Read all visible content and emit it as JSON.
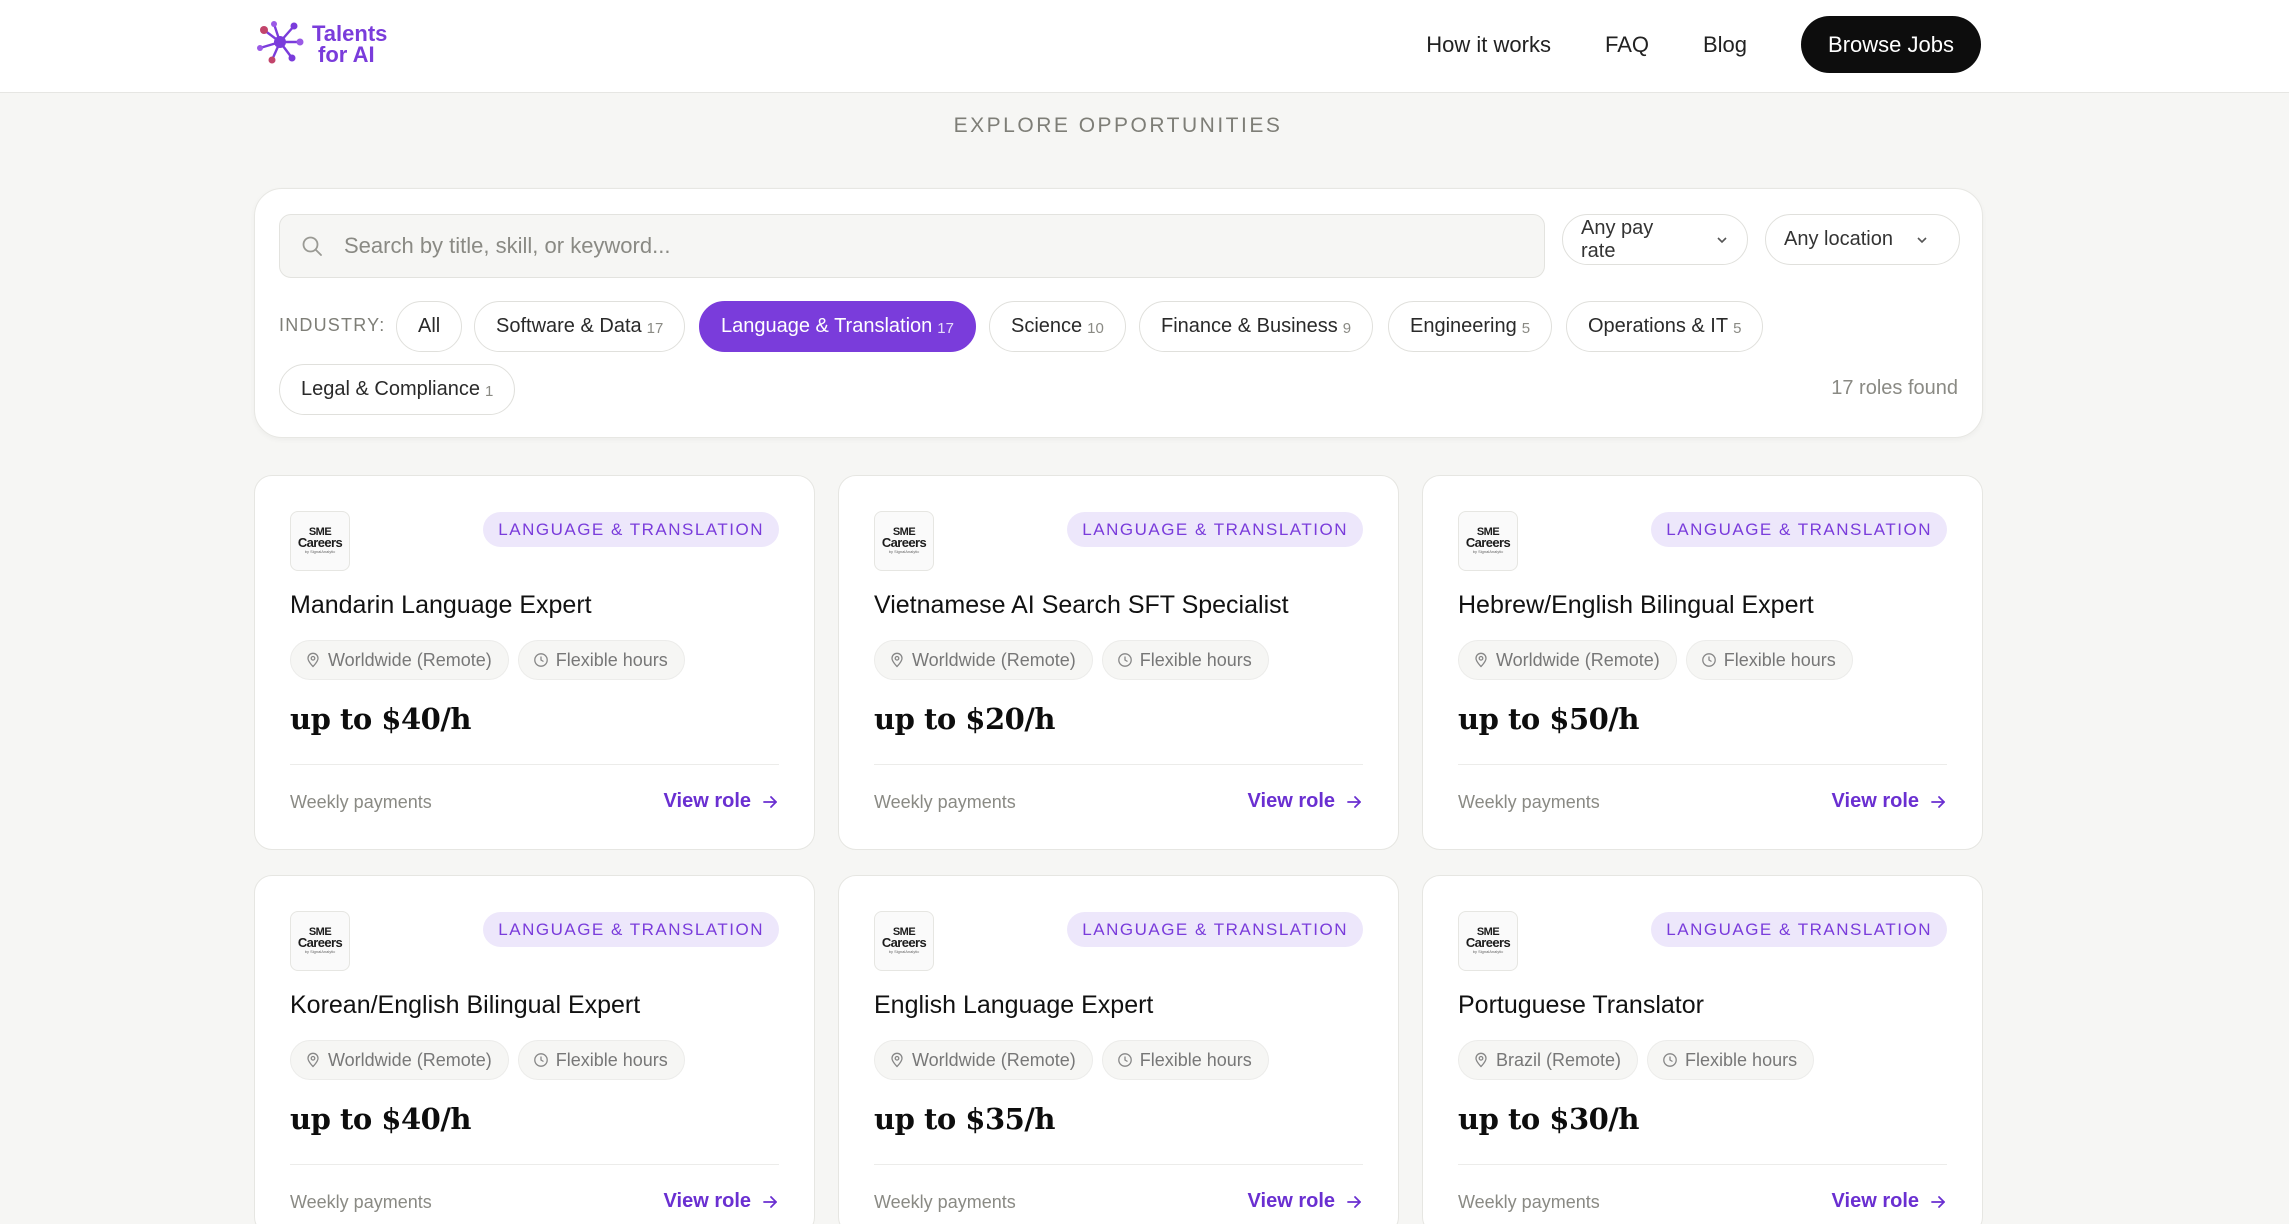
{
  "header": {
    "logo_line1": "Talents",
    "logo_line2": "for AI",
    "nav": [
      {
        "label": "How it works"
      },
      {
        "label": "FAQ"
      },
      {
        "label": "Blog"
      }
    ],
    "cta_label": "Browse Jobs"
  },
  "section": {
    "heading": "EXPLORE OPPORTUNITIES"
  },
  "filters": {
    "search_placeholder": "Search by title, skill, or keyword...",
    "search_value": "",
    "pay_rate": "Any pay rate",
    "location": "Any location",
    "industry_label": "INDUSTRY:",
    "industries": [
      {
        "label": "All",
        "count": ""
      },
      {
        "label": "Software & Data",
        "count": "17"
      },
      {
        "label": "Language & Translation",
        "count": "17"
      },
      {
        "label": "Science",
        "count": "10"
      },
      {
        "label": "Finance & Business",
        "count": "9"
      },
      {
        "label": "Engineering",
        "count": "5"
      },
      {
        "label": "Operations & IT",
        "count": "5"
      },
      {
        "label": "Legal & Compliance",
        "count": "1"
      }
    ],
    "active_industry": "Language & Translation",
    "roles_found": "17 roles found"
  },
  "company_logo": {
    "line1": "SME",
    "line2": "Careers",
    "line3": "by SignalAnalytic"
  },
  "jobs": [
    {
      "tag": "LANGUAGE & TRANSLATION",
      "title": "Mandarin Language Expert",
      "location": "Worldwide (Remote)",
      "hours": "Flexible hours",
      "pay": "up to $40/h",
      "payments": "Weekly payments",
      "cta": "View role"
    },
    {
      "tag": "LANGUAGE & TRANSLATION",
      "title": "Vietnamese AI Search SFT Specialist",
      "location": "Worldwide (Remote)",
      "hours": "Flexible hours",
      "pay": "up to $20/h",
      "payments": "Weekly payments",
      "cta": "View role"
    },
    {
      "tag": "LANGUAGE & TRANSLATION",
      "title": "Hebrew/English Bilingual Expert",
      "location": "Worldwide (Remote)",
      "hours": "Flexible hours",
      "pay": "up to $50/h",
      "payments": "Weekly payments",
      "cta": "View role"
    },
    {
      "tag": "LANGUAGE & TRANSLATION",
      "title": "Korean/English Bilingual Expert",
      "location": "Worldwide (Remote)",
      "hours": "Flexible hours",
      "pay": "up to $40/h",
      "payments": "Weekly payments",
      "cta": "View role"
    },
    {
      "tag": "LANGUAGE & TRANSLATION",
      "title": "English Language Expert",
      "location": "Worldwide (Remote)",
      "hours": "Flexible hours",
      "pay": "up to $35/h",
      "payments": "Weekly payments",
      "cta": "View role"
    },
    {
      "tag": "LANGUAGE & TRANSLATION",
      "title": "Portuguese Translator",
      "location": "Brazil (Remote)",
      "hours": "Flexible hours",
      "pay": "up to $30/h",
      "payments": "Weekly payments",
      "cta": "View role"
    }
  ],
  "colors": {
    "accent": "#7a3cdb",
    "tag_bg": "#ede7fb",
    "page_bg": "#f6f6f4",
    "cta_bg": "#0d0d0d"
  },
  "icons": {
    "logo": "network-logo-icon",
    "search": "search-icon",
    "dropdown": "chevron-down-icon",
    "location": "map-pin-icon",
    "hours": "clock-icon",
    "view": "arrow-right-icon"
  }
}
